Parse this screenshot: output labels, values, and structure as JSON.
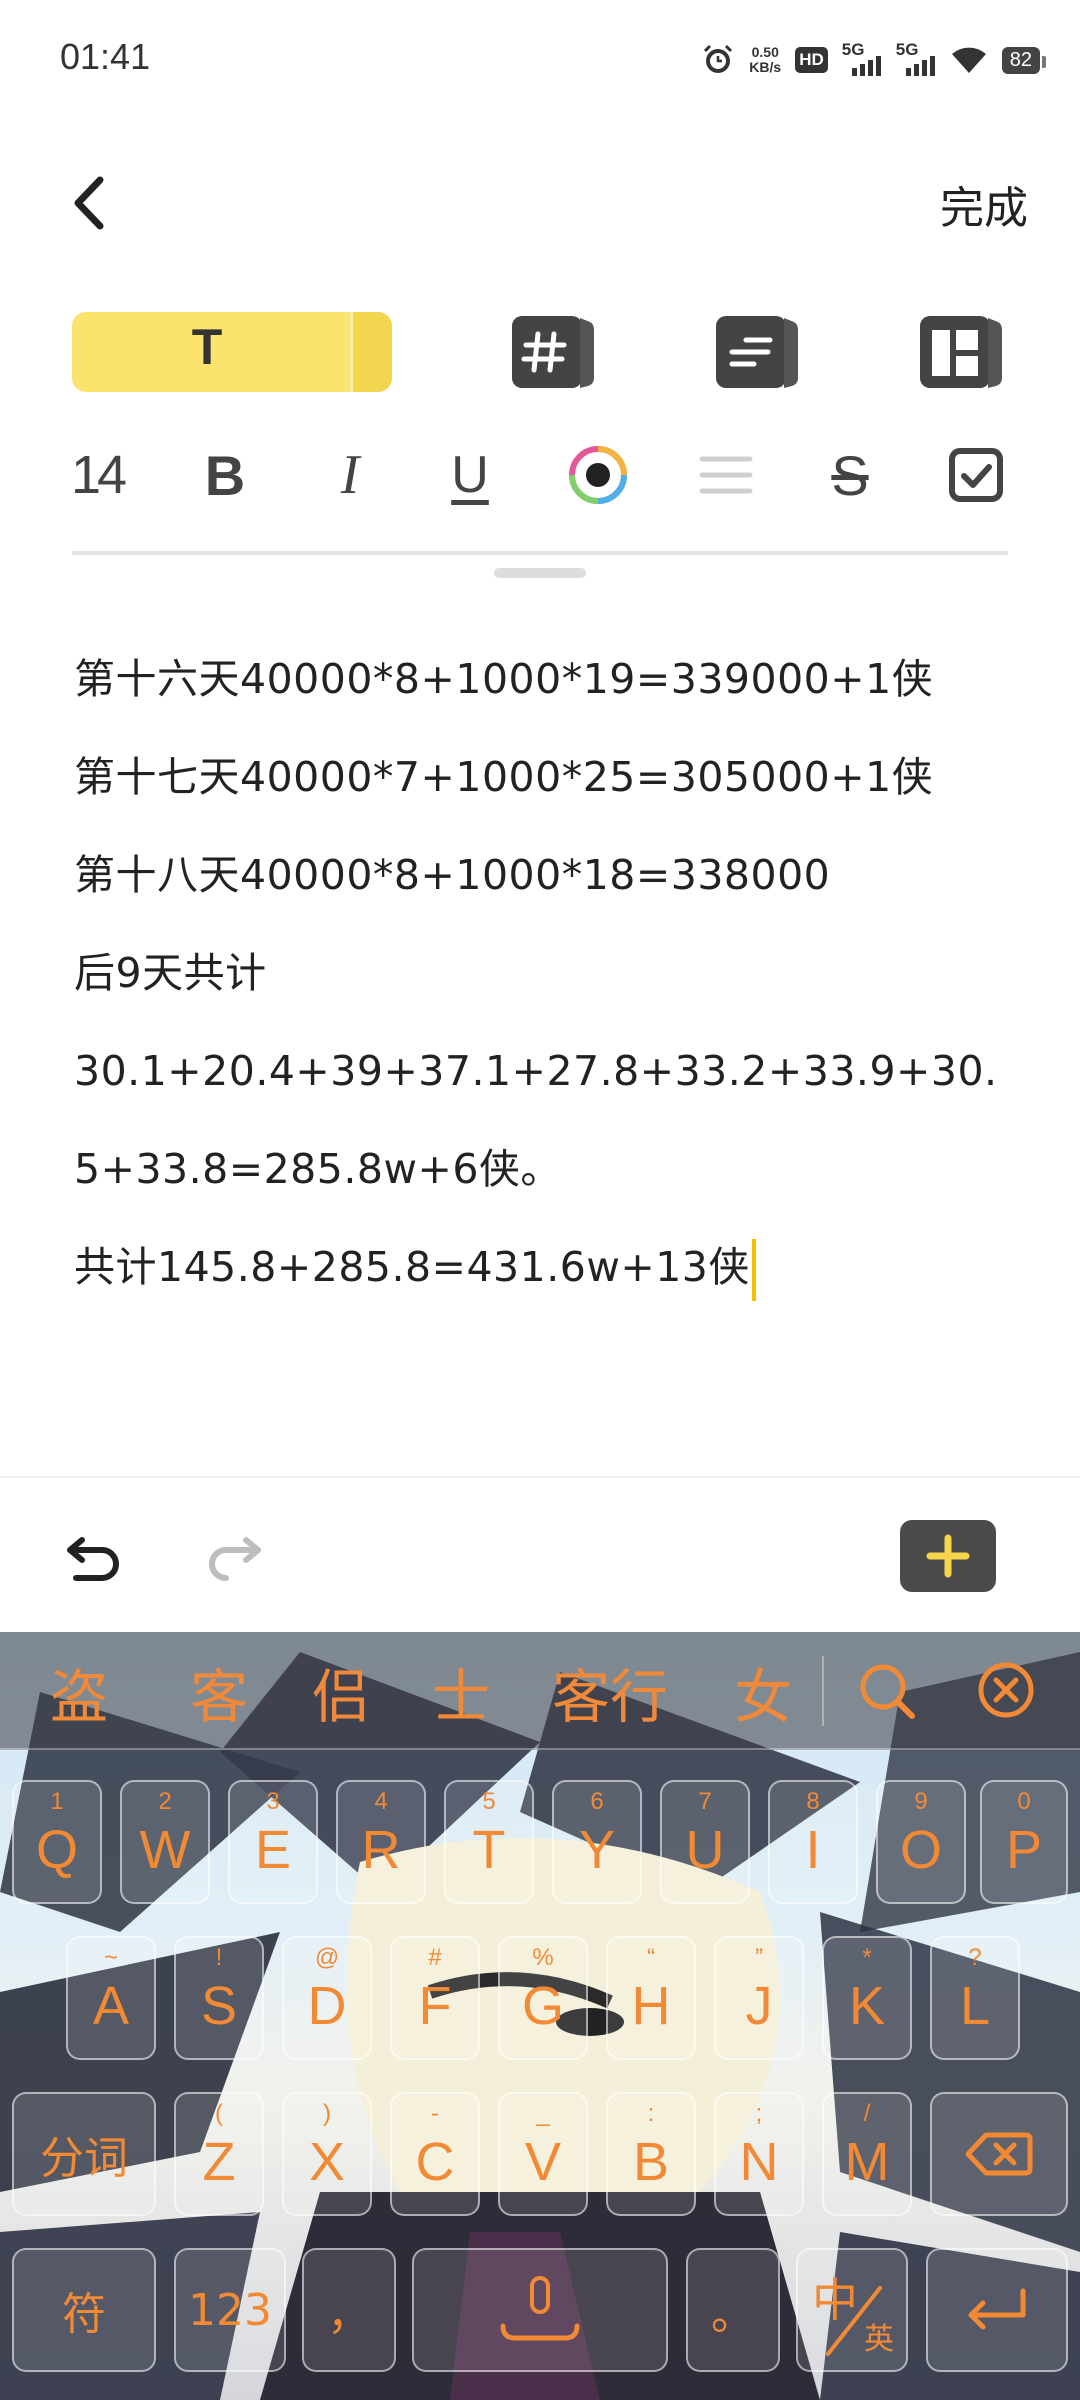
{
  "status_bar": {
    "time": "01:41",
    "net_speed_value": "0.50",
    "net_speed_unit": "KB/s",
    "hd_label": "HD",
    "signal1_label": "5G",
    "signal2_label": "5G",
    "battery": "82"
  },
  "header": {
    "done_label": "完成"
  },
  "mode_tabs": {
    "text_tab_label": "T",
    "icons": [
      "hashtag-tab-icon",
      "list-tab-icon",
      "layout-tab-icon"
    ]
  },
  "format_toolbar": {
    "font_size": "14",
    "bold": "B",
    "italic": "I",
    "underline": "U",
    "strike": "S",
    "icons": [
      "color-picker-icon",
      "align-icon",
      "checkbox-icon"
    ]
  },
  "note": {
    "lines": [
      "第十六天40000*8+1000*19=339000+1侠",
      "第十七天40000*7+1000*25=305000+1侠",
      "第十八天40000*8+1000*18=338000",
      "后9天共计",
      "30.1+20.4+39+37.1+27.8+33.2+33.9+30.",
      "5+33.8=285.8w+6侠。",
      "共计145.8+285.8=431.6w+13侠"
    ]
  },
  "bottom_bar": {
    "icons": [
      "undo-icon",
      "redo-icon",
      "add-icon"
    ]
  },
  "keyboard": {
    "candidates": [
      "盗",
      "客",
      "侣",
      "士",
      "客行",
      "女"
    ],
    "row1": [
      {
        "main": "Q",
        "sub": "1"
      },
      {
        "main": "W",
        "sub": "2"
      },
      {
        "main": "E",
        "sub": "3"
      },
      {
        "main": "R",
        "sub": "4"
      },
      {
        "main": "T",
        "sub": "5"
      },
      {
        "main": "Y",
        "sub": "6"
      },
      {
        "main": "U",
        "sub": "7"
      },
      {
        "main": "I",
        "sub": "8"
      },
      {
        "main": "O",
        "sub": "9"
      },
      {
        "main": "P",
        "sub": "0"
      }
    ],
    "row2": [
      {
        "main": "A",
        "sub": "~"
      },
      {
        "main": "S",
        "sub": "!"
      },
      {
        "main": "D",
        "sub": "@"
      },
      {
        "main": "F",
        "sub": "#"
      },
      {
        "main": "G",
        "sub": "%"
      },
      {
        "main": "H",
        "sub": "“"
      },
      {
        "main": "J",
        "sub": "”"
      },
      {
        "main": "K",
        "sub": "*"
      },
      {
        "main": "L",
        "sub": "?"
      }
    ],
    "row3_fn": "分词",
    "row3": [
      {
        "main": "Z",
        "sub": "("
      },
      {
        "main": "X",
        "sub": ")"
      },
      {
        "main": "C",
        "sub": "-"
      },
      {
        "main": "V",
        "sub": "_"
      },
      {
        "main": "B",
        "sub": ":"
      },
      {
        "main": "N",
        "sub": ";"
      },
      {
        "main": "M",
        "sub": "/"
      }
    ],
    "row4": {
      "symbols": "符",
      "numbers": "123",
      "comma": "，",
      "period": "。",
      "lang_main": "中",
      "lang_sub": "英"
    }
  }
}
